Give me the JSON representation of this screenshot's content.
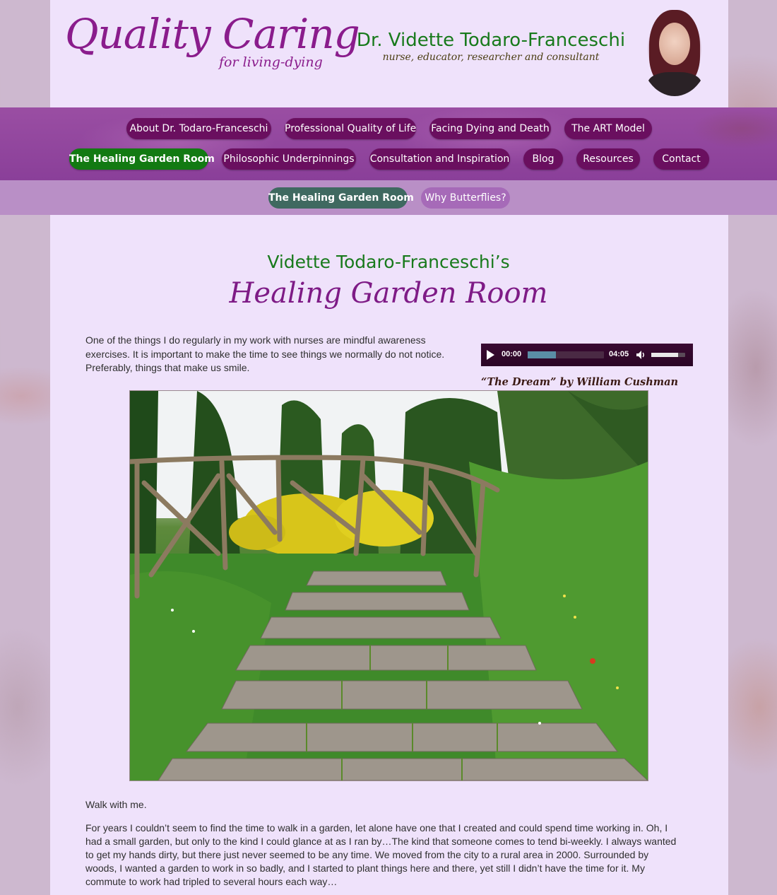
{
  "header": {
    "logo_main": "Quality Caring",
    "logo_sub": "for living-dying",
    "doctor_name": "Dr. Vidette Todaro-Franceschi",
    "doctor_subtitle": "nurse, educator, researcher and consultant"
  },
  "nav": {
    "row1": [
      "About Dr. Todaro-Franceschi",
      "Professional Quality of Life",
      "Facing Dying and Death",
      "The ART Model"
    ],
    "row2": [
      "The Healing Garden Room",
      "Philosophic Underpinnings",
      "Consultation and Inspiration",
      "Blog",
      "Resources",
      "Contact"
    ]
  },
  "subnav": {
    "items": [
      "The Healing Garden Room",
      "Why Butterflies?"
    ]
  },
  "content": {
    "title_line1": "Vidette Todaro-Franceschi’s",
    "title_line2": "Healing Garden Room",
    "intro": "One of the things I do regularly in my work with nurses are mindful awareness exercises. It is important to make the time to see things we normally do not notice. Preferably, things that make us smile.",
    "walk": "Walk with me.",
    "paragraph": "For years I couldn’t seem to find the time to walk in a garden, let alone have one that I created and could spend time working in. Oh, I had a small garden, but only to the kind I could glance at as I ran by…The kind that someone comes to tend bi-weekly. I always wanted to get my hands dirty, but there just never seemed to be any time. We moved from the city to a rural area in 2000. Surrounded by woods, I wanted a garden to work in so badly, and I started to plant things here and there, yet still I didn’t have the time for it. My commute to work had tripled to several hours each way…"
  },
  "audio": {
    "current_time": "00:00",
    "duration": "04:05",
    "loaded_fraction": 0.37,
    "volume_fraction": 0.8,
    "caption": "“The Dream” by William Cushman"
  },
  "colors": {
    "brand_purple": "#8a1c8c",
    "brand_green": "#187a1c",
    "nav_pill": "#6a0f5f",
    "active_pill": "#127a12",
    "sub_active_pill": "#3f6960"
  }
}
